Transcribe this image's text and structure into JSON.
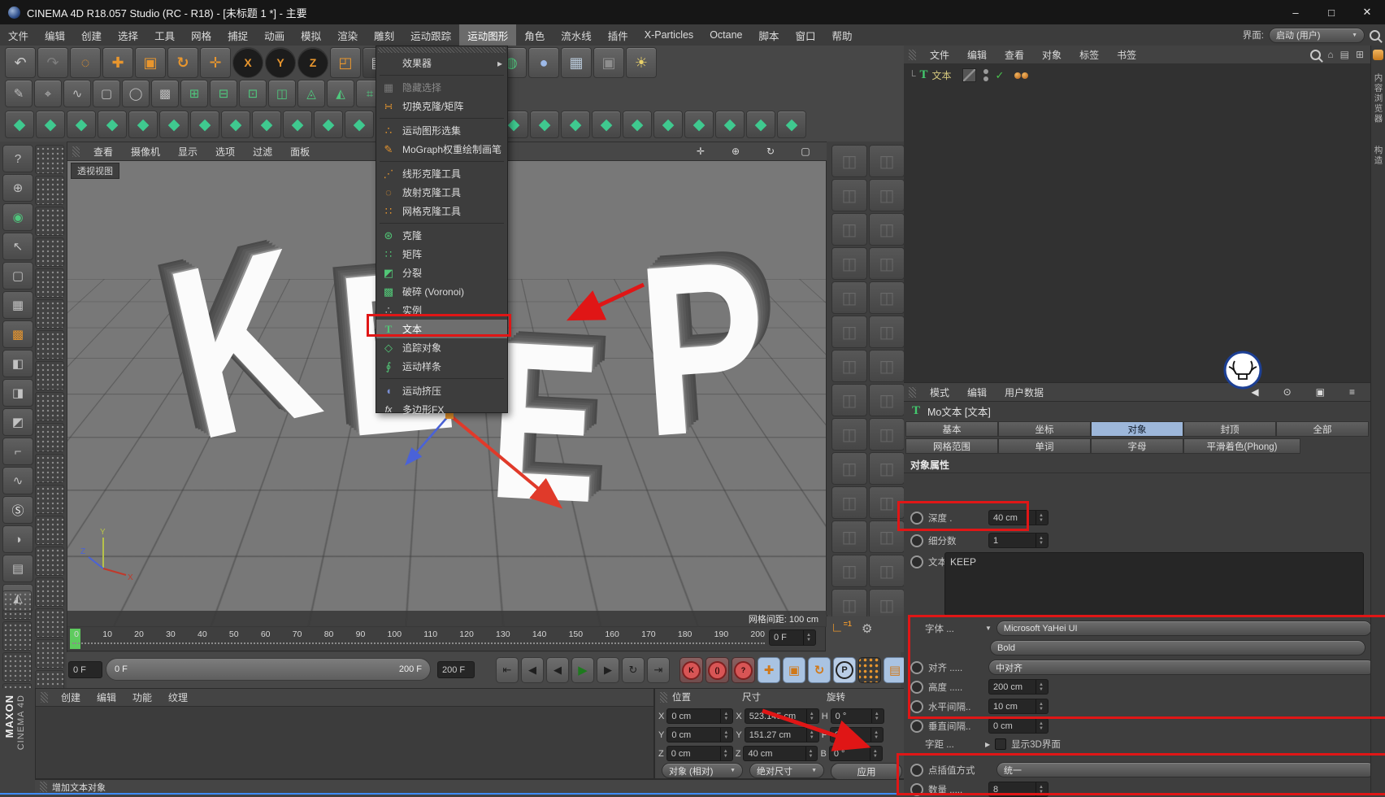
{
  "window": {
    "title": "CINEMA 4D R18.057 Studio (RC - R18) - [未标题 1 *] - 主要",
    "minimize": "–",
    "maximize": "□",
    "close": "✕"
  },
  "menubar": {
    "items": [
      "文件",
      "编辑",
      "创建",
      "选择",
      "工具",
      "网格",
      "捕捉",
      "动画",
      "模拟",
      "渲染",
      "雕刻",
      "运动跟踪",
      "运动图形",
      "角色",
      "流水线",
      "插件",
      "X-Particles",
      "Octane",
      "脚本",
      "窗口",
      "帮助"
    ],
    "active_item": "运动图形",
    "interface_label": "界面:",
    "interface_value": "启动 (用户)"
  },
  "toolbar": {
    "row1": [
      "↶",
      "↷",
      "◌",
      "✚",
      "▣",
      "↻",
      "✛",
      "X",
      "Y",
      "Z",
      "◰",
      "▤",
      "▥",
      "⚙",
      "◉",
      "◍",
      "●",
      "▦",
      "▣",
      "☀"
    ],
    "row2": [
      "✎",
      "⌖",
      "∿",
      "▢",
      "◯",
      "▩",
      "⊞",
      "⊟",
      "⊡",
      "◫",
      "◬",
      "◭",
      "⌗",
      "fx"
    ]
  },
  "left_dock": {
    "tools": [
      "?",
      "⊕",
      "◉",
      "↖",
      "▢",
      "▦",
      "▩",
      "◧",
      "◨",
      "◩",
      "⌐",
      "∿",
      "Ⓢ",
      "◑",
      "▤",
      "◭"
    ]
  },
  "viewport": {
    "menu": [
      "查看",
      "摄像机",
      "显示",
      "选项",
      "过滤",
      "面板"
    ],
    "nav_icons": [
      "✛",
      "⊕",
      "↻",
      "▢"
    ],
    "label": "透视视图",
    "grid_info": "网格间距: 100 cm",
    "letters": [
      "K",
      "E",
      "E",
      "P"
    ],
    "axis_x": "X",
    "axis_y": "Y",
    "axis_z": "Z"
  },
  "mograph_menu": {
    "items": [
      {
        "label": "效果器",
        "glyph": ""
      },
      {
        "label": "隐藏选择",
        "glyph": "▦"
      },
      {
        "label": "切换克隆/矩阵",
        "glyph": "∺"
      },
      {
        "label": "运动图形选集",
        "glyph": "∴"
      },
      {
        "label": "MoGraph权重绘制画笔",
        "glyph": "✎"
      },
      {
        "label": "线形克隆工具",
        "glyph": "⋰"
      },
      {
        "label": "放射克隆工具",
        "glyph": "◌"
      },
      {
        "label": "网格克隆工具",
        "glyph": "∷"
      },
      {
        "label": "克隆",
        "glyph": "⊛"
      },
      {
        "label": "矩阵",
        "glyph": "∷"
      },
      {
        "label": "分裂",
        "glyph": "◩"
      },
      {
        "label": "破碎 (Voronoi)",
        "glyph": "▩"
      },
      {
        "label": "实例",
        "glyph": "∴"
      },
      {
        "label": "文本",
        "glyph": "T"
      },
      {
        "label": "追踪对象",
        "glyph": "◇"
      },
      {
        "label": "运动样条",
        "glyph": "∮"
      },
      {
        "label": "运动挤压",
        "glyph": "◖"
      },
      {
        "label": "多边形FX",
        "glyph": "fx"
      }
    ]
  },
  "timeline": {
    "ticks": [
      "0",
      "10",
      "20",
      "30",
      "40",
      "50",
      "60",
      "70",
      "80",
      "90",
      "100",
      "110",
      "120",
      "130",
      "140",
      "150",
      "160",
      "170",
      "180",
      "190",
      "200"
    ],
    "current": "0 F",
    "range_start": "0 F",
    "range_end": "200 F",
    "end_frame": "200 F"
  },
  "transport": {
    "buttons": [
      "⇤",
      "◀",
      "◀",
      "▶",
      "▶",
      "↻",
      "⇥"
    ],
    "record": [
      "K",
      "()",
      "?"
    ],
    "tools": [
      "✚",
      "▣",
      "↻"
    ],
    "p_label": "P"
  },
  "anim_extra": {
    "axis_glyph": "∟",
    "eq": "=1",
    "gear": "⚙",
    "film": "▤"
  },
  "material_manager": {
    "menu": [
      "创建",
      "编辑",
      "功能",
      "纹理"
    ]
  },
  "coords": {
    "pos_title": "位置",
    "size_title": "尺寸",
    "rot_title": "旋转",
    "rows": [
      {
        "pl": "X",
        "pv": "0 cm",
        "sl": "X",
        "sv": "523.145 cm",
        "rl": "H",
        "rv": "0 °"
      },
      {
        "pl": "Y",
        "pv": "0 cm",
        "sl": "Y",
        "sv": "151.27 cm",
        "rl": "P",
        "rv": "0 °"
      },
      {
        "pl": "Z",
        "pv": "0 cm",
        "sl": "Z",
        "sv": "40 cm",
        "rl": "B",
        "rv": "0 °"
      }
    ],
    "mode_object": "对象 (相对)",
    "mode_size": "绝对尺寸",
    "apply": "应用"
  },
  "object_manager": {
    "menu": [
      "文件",
      "编辑",
      "查看",
      "对象",
      "标签",
      "书签"
    ],
    "right_icons": [
      "⌂",
      "▤",
      "⊞"
    ],
    "object_name": "文本",
    "object_icon": "T",
    "enabled_check": "✓"
  },
  "attributes": {
    "menu": [
      "模式",
      "编辑",
      "用户数据"
    ],
    "right_icons": [
      "◀",
      "⊙",
      "▣",
      "≡"
    ],
    "title_icon": "T",
    "title": "Mo文本 [文本]",
    "tabs_row1": [
      "基本",
      "坐标",
      "对象",
      "封顶",
      "全部"
    ],
    "active_tab": "对象",
    "tabs_row2": [
      "网格范围",
      "单词",
      "字母",
      "平滑着色(Phong)"
    ],
    "section": "对象属性",
    "depth_label": "深度 .",
    "depth_value": "40 cm",
    "subd_label": "细分数",
    "subd_value": "1",
    "text_label": "文本",
    "text_value": "KEEP",
    "font_label": "字体 ...",
    "font_value": "Microsoft YaHei UI",
    "font_style": "Bold",
    "align_label": "对齐 .....",
    "align_value": "中对齐",
    "height_label": "高度 .....",
    "height_value": "200 cm",
    "hspace_label": "水平间隔..",
    "hspace_value": "10 cm",
    "vspace_label": "垂直间隔..",
    "vspace_value": "0 cm",
    "kern_label": "字距 ...",
    "kern_check": "显示3D界面",
    "interp_label": "点插值方式",
    "interp_value": "统一",
    "count_label": "数量 .....",
    "count_value": "8"
  },
  "right_strip": {
    "labels": [
      "内容浏览器",
      "构造"
    ]
  },
  "status": {
    "message": "增加文本对象"
  },
  "branding": {
    "maxon": "MAXON",
    "cinema": "CINEMA 4D"
  },
  "colors": {
    "annotation_red": "#e01616",
    "accent_orange": "#e8962e",
    "mograph_green": "#52c777",
    "tab_active_blue": "#9db7da",
    "playhead_green": "#5ecb5e"
  }
}
